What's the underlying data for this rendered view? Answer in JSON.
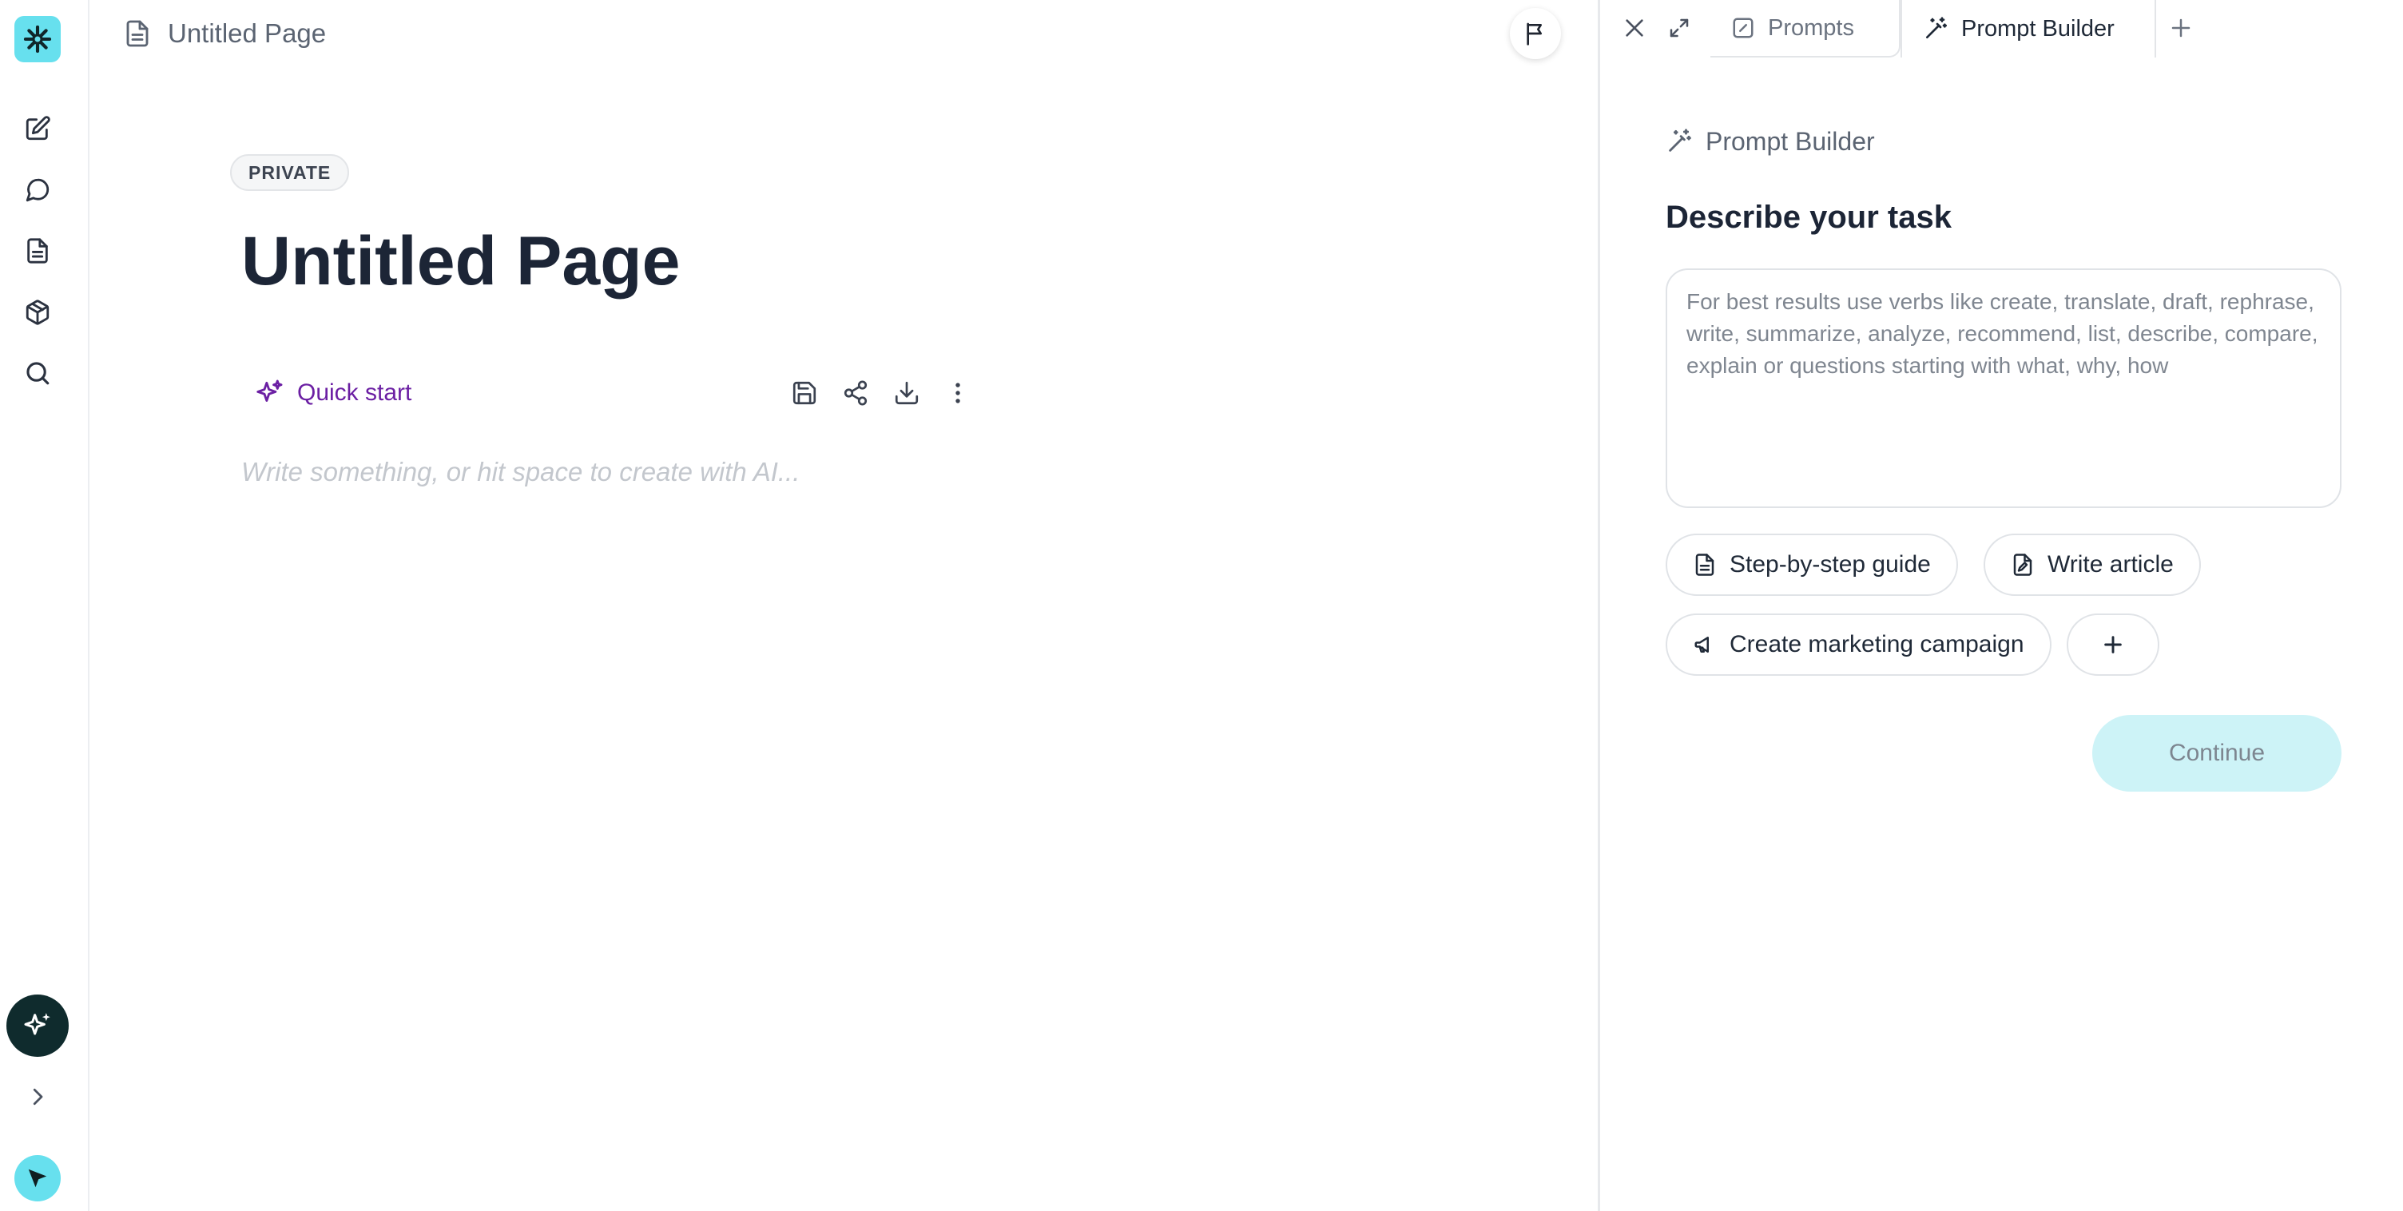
{
  "colors": {
    "accent_cyan": "#67e0ee",
    "ai_fab": "#0f2b2d",
    "quick_start": "#6b1fa3",
    "continue_bg": "#cdf3f7"
  },
  "rail": {
    "logo_icon": "asterisk-logo",
    "items": [
      {
        "icon": "edit-icon"
      },
      {
        "icon": "chat-bubble-icon"
      },
      {
        "icon": "document-icon"
      },
      {
        "icon": "box-icon"
      },
      {
        "icon": "search-icon"
      }
    ],
    "ai_button_icon": "sparkle-icon",
    "expand_icon": "chevron-right-icon",
    "cursor_icon": "cursor-arrow-icon"
  },
  "editor": {
    "breadcrumb_title": "Untitled Page",
    "visibility_badge": "PRIVATE",
    "page_title": "Untitled Page",
    "quick_start_label": "Quick start",
    "toolbar_icons": [
      "save-icon",
      "share-icon",
      "download-icon",
      "more-vertical-icon"
    ],
    "body_placeholder": "Write something, or hit space to create with AI..."
  },
  "panel": {
    "tabs": [
      {
        "label": "Prompts",
        "icon": "edit-square-icon",
        "active": false
      },
      {
        "label": "Prompt Builder",
        "icon": "magic-wand-icon",
        "active": true
      }
    ],
    "header_label": "Prompt Builder",
    "heading": "Describe your task",
    "input_placeholder": "For best results use verbs like create, translate, draft, rephrase, write, summarize, analyze, recommend, list, describe, compare, explain or questions starting with what, why, how",
    "input_value": "",
    "chips": [
      {
        "label": "Step-by-step guide",
        "icon": "document-icon"
      },
      {
        "label": "Write article",
        "icon": "file-edit-icon"
      },
      {
        "label": "Create marketing campaign",
        "icon": "megaphone-icon"
      }
    ],
    "continue_label": "Continue"
  }
}
